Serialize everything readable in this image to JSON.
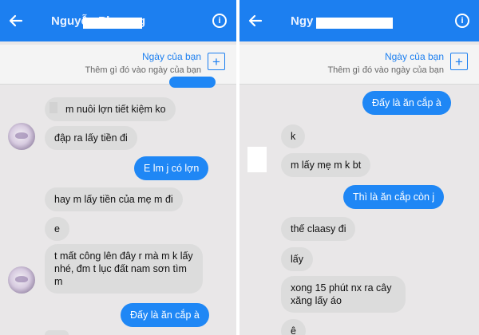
{
  "colors": {
    "header": "#1c7ff0",
    "bubble_out": "#1f87f5",
    "bubble_in": "#dcdcdc",
    "chat_bg": "#e9e7e8"
  },
  "left": {
    "header": {
      "title": "Nguyễn Phương",
      "back_icon": "arrow-left-icon",
      "info_icon": "info-icon"
    },
    "day_banner": {
      "title": "Ngày của bạn",
      "subtitle": "Thêm gì đó vào ngày của bạn",
      "add_icon": "plus-icon"
    },
    "messages": [
      {
        "text": "m nuôi lợn tiết kiệm ko"
      },
      {
        "text": "đập ra lấy tiền đi"
      },
      {
        "text": "E lm j có lợn"
      },
      {
        "text": "hay m lấy tiền của mẹ m đi"
      },
      {
        "text": "e"
      },
      {
        "text": "t mất công lên đây r mà m k lấy nhé, đm t lục đất nam sơn tìm m"
      },
      {
        "text": "Đấy là ăn cắp à"
      }
    ]
  },
  "right": {
    "header": {
      "title": "Ngy",
      "back_icon": "arrow-left-icon",
      "info_icon": "info-icon"
    },
    "day_banner": {
      "title": "Ngày của bạn",
      "subtitle": "Thêm gì đó vào ngày của bạn",
      "add_icon": "plus-icon"
    },
    "messages": [
      {
        "text": "Đấy là ăn cắp à"
      },
      {
        "text": "k"
      },
      {
        "text": "m lấy mẹ m k bt"
      },
      {
        "text": "Thì là ăn cắp còn j"
      },
      {
        "text": "thế claasy đi"
      },
      {
        "text": "lấy"
      },
      {
        "text": "xong 15 phút nx ra cây xăng lấy áo"
      },
      {
        "text": "ê"
      }
    ]
  }
}
